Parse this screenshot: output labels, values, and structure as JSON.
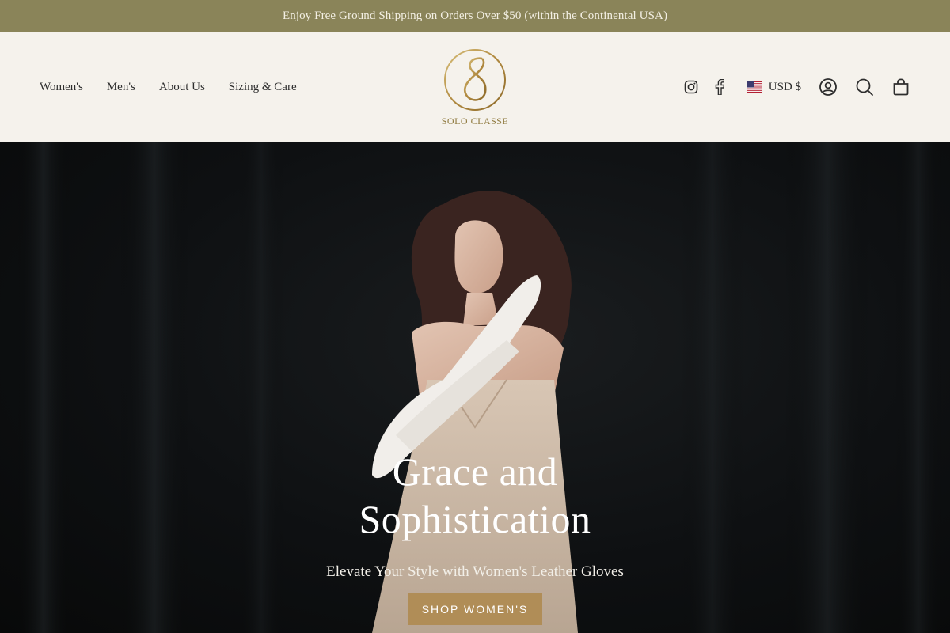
{
  "announcement": {
    "text": "Enjoy Free Ground Shipping on Orders Over $50 (within the Continental USA)"
  },
  "nav": {
    "items": [
      {
        "label": "Women's"
      },
      {
        "label": "Men's"
      },
      {
        "label": "About Us"
      },
      {
        "label": "Sizing & Care"
      }
    ]
  },
  "brand": {
    "logo_text": "SOLO CLASSE"
  },
  "header_tools": {
    "social": [
      "instagram-icon",
      "facebook-icon"
    ],
    "currency": {
      "label": "USD $",
      "flag": "us-flag-icon"
    },
    "icons": [
      "account-icon",
      "search-icon",
      "cart-icon"
    ]
  },
  "hero": {
    "title": "Grace and Sophistication",
    "subtitle": "Elevate Your Style with Women's Leather Gloves",
    "cta_label": "SHOP WOMEN'S"
  },
  "colors": {
    "announcement_bg": "#8a8459",
    "header_bg": "#f5f2ec",
    "accent_gold": "#b08d57",
    "hero_bg": "#0e1012"
  }
}
